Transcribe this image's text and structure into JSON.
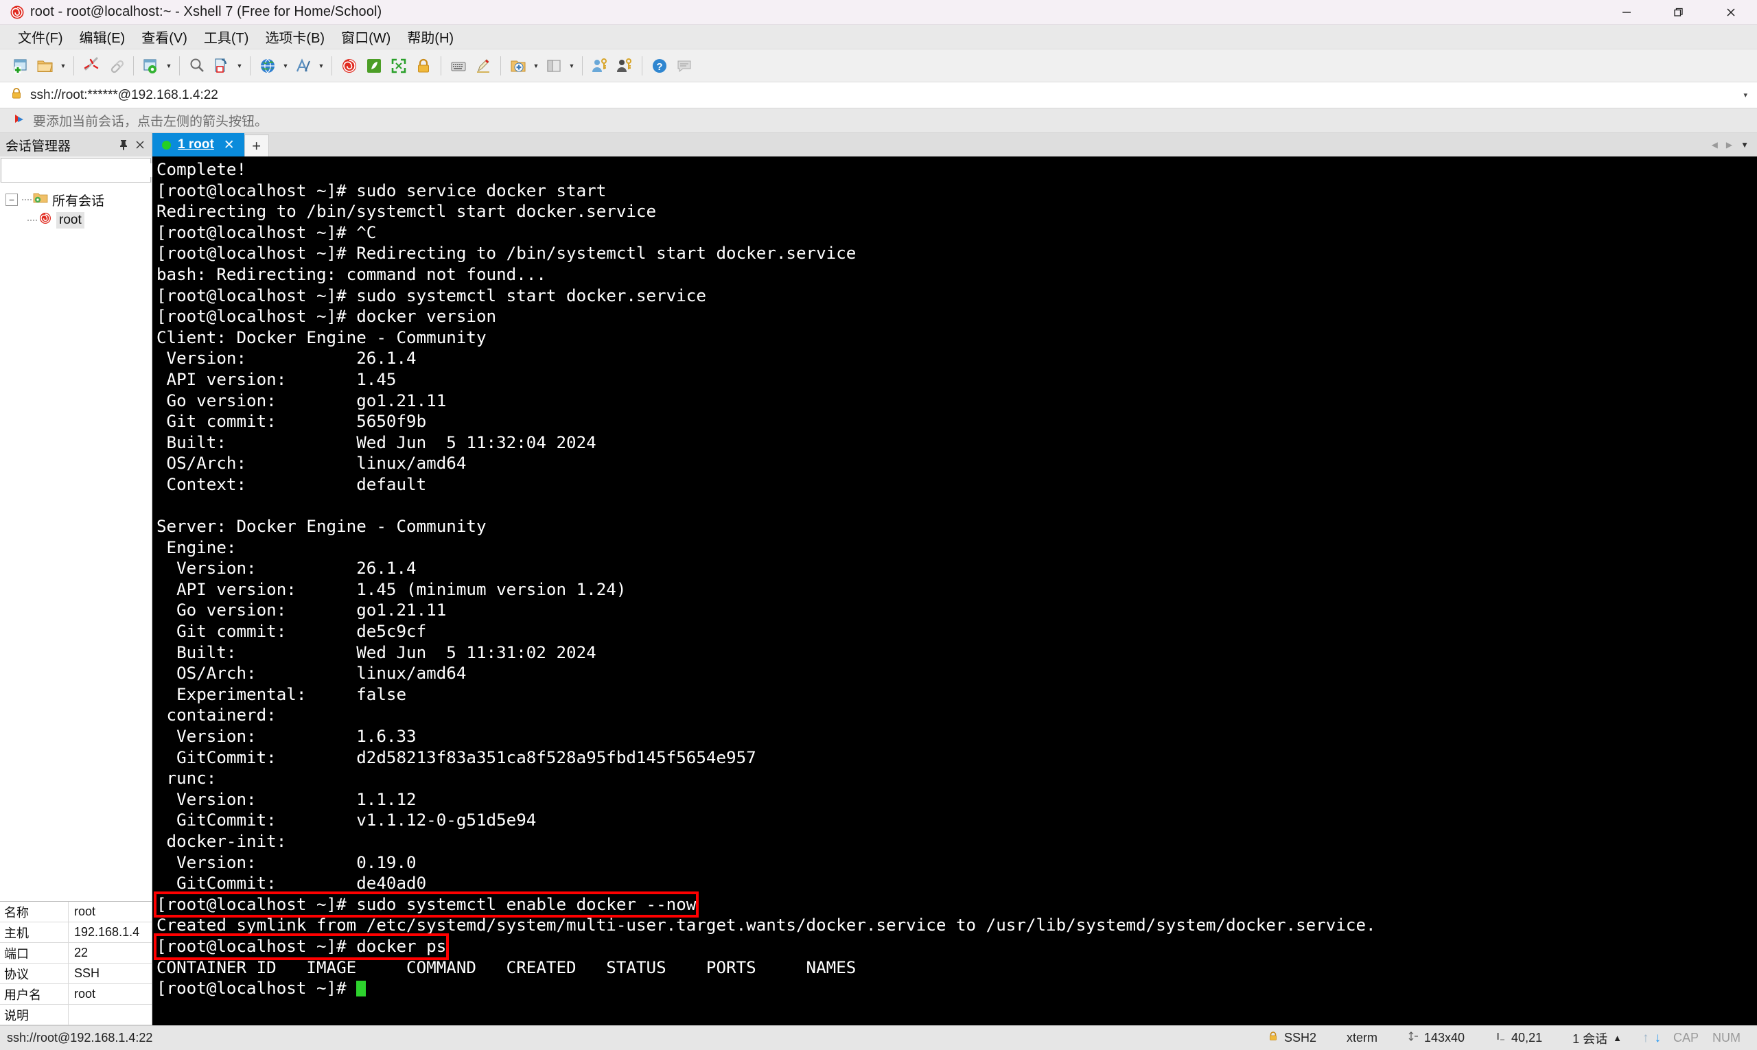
{
  "window": {
    "title": "root - root@localhost:~ - Xshell 7 (Free for Home/School)",
    "app_icon": "xshell-logo-icon",
    "minimize": "—",
    "maximize": "❐",
    "close": "✕"
  },
  "menubar": {
    "items": [
      {
        "label": "文件(F)",
        "name": "menu-file"
      },
      {
        "label": "编辑(E)",
        "name": "menu-edit"
      },
      {
        "label": "查看(V)",
        "name": "menu-view"
      },
      {
        "label": "工具(T)",
        "name": "menu-tools"
      },
      {
        "label": "选项卡(B)",
        "name": "menu-tabs"
      },
      {
        "label": "窗口(W)",
        "name": "menu-window"
      },
      {
        "label": "帮助(H)",
        "name": "menu-help"
      }
    ]
  },
  "toolbar": {
    "buttons": [
      {
        "name": "new-session-icon",
        "glyph": "new"
      },
      {
        "name": "open-session-icon",
        "glyph": "folder",
        "caret": true
      },
      {
        "sep": true
      },
      {
        "name": "disconnect-icon",
        "glyph": "disconnect"
      },
      {
        "name": "reconnect-icon",
        "glyph": "link"
      },
      {
        "sep": true
      },
      {
        "name": "session-properties-icon",
        "glyph": "props",
        "caret": true
      },
      {
        "sep": true
      },
      {
        "name": "find-icon",
        "glyph": "search"
      },
      {
        "name": "log-icon",
        "glyph": "log",
        "caret": true
      },
      {
        "sep": true
      },
      {
        "name": "globe-encoding-icon",
        "glyph": "globe",
        "caret": true
      },
      {
        "name": "font-icon",
        "glyph": "font",
        "caret": true
      },
      {
        "sep": true
      },
      {
        "name": "xshell-icon",
        "glyph": "xshell"
      },
      {
        "name": "xftp-icon",
        "glyph": "xftp"
      },
      {
        "name": "fullscreen-icon",
        "glyph": "fullscreen"
      },
      {
        "name": "lock-icon",
        "glyph": "lock"
      },
      {
        "sep": true
      },
      {
        "name": "keyboard-icon",
        "glyph": "keyboard"
      },
      {
        "name": "highlight-icon",
        "glyph": "pen"
      },
      {
        "sep": true
      },
      {
        "name": "new-folder-icon",
        "glyph": "newfolder",
        "caret": true
      },
      {
        "name": "layout-icon",
        "glyph": "layout",
        "caret": true
      },
      {
        "sep": true
      },
      {
        "name": "user-keys-icon",
        "glyph": "userkey"
      },
      {
        "name": "master-password-icon",
        "glyph": "masterkey"
      },
      {
        "sep": true
      },
      {
        "name": "help-icon",
        "glyph": "help"
      },
      {
        "name": "feedback-icon",
        "glyph": "note"
      }
    ]
  },
  "address_bar": {
    "lock_icon": "lock-icon",
    "value": "ssh://root:******@192.168.1.4:22",
    "dropdown_caret": "▾"
  },
  "hint_bar": {
    "icon": "add-session-arrow-icon",
    "text": "要添加当前会话，点击左侧的箭头按钮。"
  },
  "sidebar": {
    "title": "会话管理器",
    "pin_icon": "pin-icon",
    "close_icon": "close-icon",
    "search": {
      "value": "",
      "placeholder": "",
      "icon": "search-icon"
    },
    "tree": {
      "root": {
        "label": "所有会话",
        "icon": "folder-sessions-icon",
        "expand_glyph": "−"
      },
      "children": [
        {
          "label": "root",
          "icon": "xshell-session-icon",
          "selected": true
        }
      ]
    },
    "properties": [
      {
        "key": "名称",
        "value": "root"
      },
      {
        "key": "主机",
        "value": "192.168.1.4"
      },
      {
        "key": "端口",
        "value": "22"
      },
      {
        "key": "协议",
        "value": "SSH"
      },
      {
        "key": "用户名",
        "value": "root"
      },
      {
        "key": "说明",
        "value": ""
      }
    ]
  },
  "tabbar": {
    "tabs": [
      {
        "label": "1 root",
        "status_dot_color": "#25d025",
        "close": "✕",
        "active": true
      }
    ],
    "add_tab": "+",
    "nav_prev": "◀",
    "nav_next": "▶",
    "nav_menu": "▼"
  },
  "terminal": {
    "lines": [
      {
        "text": "Complete!"
      },
      {
        "text": "[root@localhost ~]# sudo service docker start"
      },
      {
        "text": "Redirecting to /bin/systemctl start docker.service"
      },
      {
        "text": "[root@localhost ~]# ^C"
      },
      {
        "text": "[root@localhost ~]# Redirecting to /bin/systemctl start docker.service"
      },
      {
        "text": "bash: Redirecting: command not found..."
      },
      {
        "text": "[root@localhost ~]# sudo systemctl start docker.service"
      },
      {
        "text": "[root@localhost ~]# docker version"
      },
      {
        "text": "Client: Docker Engine - Community"
      },
      {
        "text": " Version:           26.1.4"
      },
      {
        "text": " API version:       1.45"
      },
      {
        "text": " Go version:        go1.21.11"
      },
      {
        "text": " Git commit:        5650f9b"
      },
      {
        "text": " Built:             Wed Jun  5 11:32:04 2024"
      },
      {
        "text": " OS/Arch:           linux/amd64"
      },
      {
        "text": " Context:           default"
      },
      {
        "text": ""
      },
      {
        "text": "Server: Docker Engine - Community"
      },
      {
        "text": " Engine:"
      },
      {
        "text": "  Version:          26.1.4"
      },
      {
        "text": "  API version:      1.45 (minimum version 1.24)"
      },
      {
        "text": "  Go version:       go1.21.11"
      },
      {
        "text": "  Git commit:       de5c9cf"
      },
      {
        "text": "  Built:            Wed Jun  5 11:31:02 2024"
      },
      {
        "text": "  OS/Arch:          linux/amd64"
      },
      {
        "text": "  Experimental:     false"
      },
      {
        "text": " containerd:"
      },
      {
        "text": "  Version:          1.6.33"
      },
      {
        "text": "  GitCommit:        d2d58213f83a351ca8f528a95fbd145f5654e957"
      },
      {
        "text": " runc:"
      },
      {
        "text": "  Version:          1.1.12"
      },
      {
        "text": "  GitCommit:        v1.1.12-0-g51d5e94"
      },
      {
        "text": " docker-init:"
      },
      {
        "text": "  Version:          0.19.0"
      },
      {
        "text": "  GitCommit:        de40ad0"
      },
      {
        "text": "[root@localhost ~]# sudo systemctl enable docker --now",
        "highlight": true
      },
      {
        "text": "Created symlink from /etc/systemd/system/multi-user.target.wants/docker.service to /usr/lib/systemd/system/docker.service."
      },
      {
        "text": "[root@localhost ~]# docker ps",
        "highlight": true
      },
      {
        "text": "CONTAINER ID   IMAGE     COMMAND   CREATED   STATUS    PORTS     NAMES"
      },
      {
        "text": "[root@localhost ~]# ",
        "cursor": true
      }
    ],
    "highlight_color": "#ff0000",
    "cursor_color": "#2dd22d",
    "background": "#000000",
    "foreground": "#ffffff"
  },
  "statusbar": {
    "connection": "ssh://root@192.168.1.4:22",
    "protocol": "SSH2",
    "protocol_icon": "lock-icon",
    "terminal_type": "xterm",
    "size_icon": "resize-icon",
    "size": "143x40",
    "cursor_icon": "cursor-pos-icon",
    "cursor_pos": "40,21",
    "sessions": "1 会话",
    "sessions_caret": "▲",
    "upload_icon": "arrow-up-icon",
    "download_icon": "arrow-down-icon",
    "caps": "CAP",
    "num": "NUM"
  }
}
